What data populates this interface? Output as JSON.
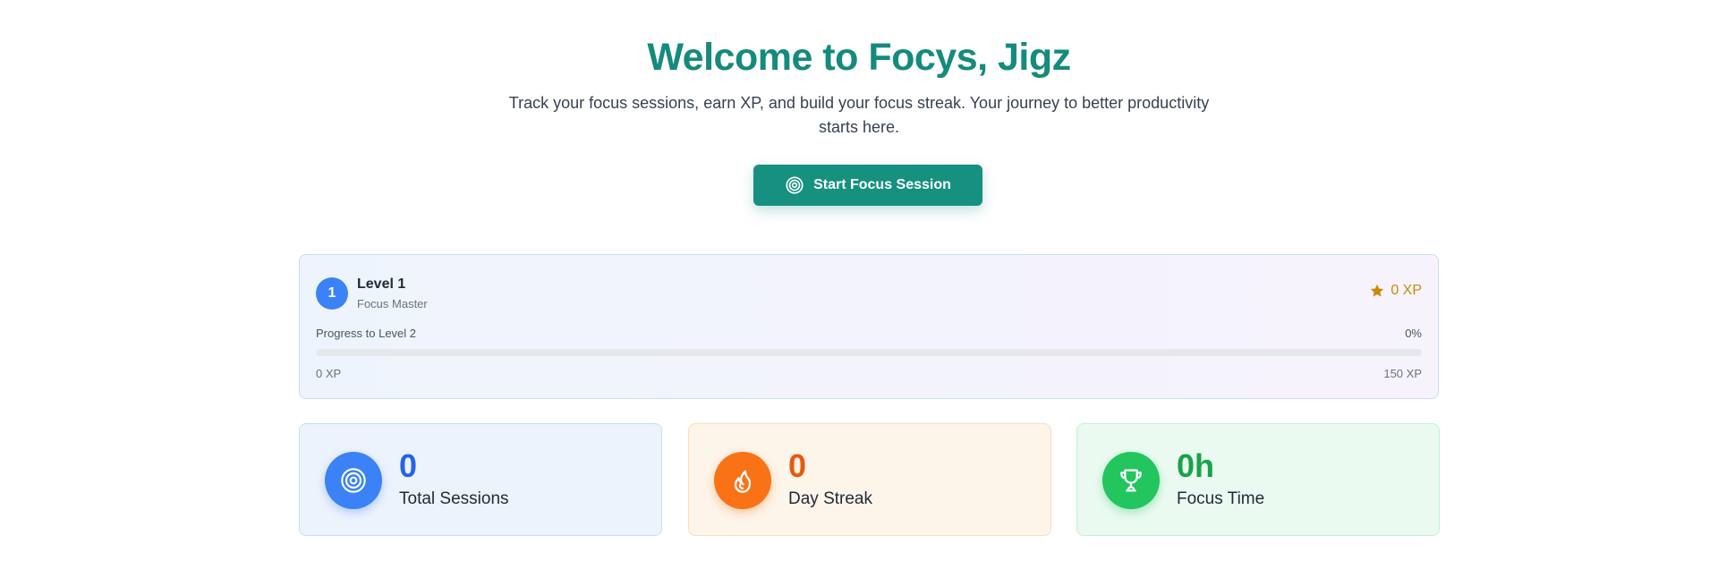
{
  "hero": {
    "title": "Welcome to Focys, Jigz",
    "subtitle": "Track your focus sessions, earn XP, and build your focus streak. Your journey to better productivity starts here.",
    "start_button": {
      "label": "Start Focus Session",
      "icon": "target-icon"
    }
  },
  "level": {
    "number": "1",
    "title": "Level 1",
    "subtitle": "Focus Master",
    "xp_label": "0 XP",
    "xp_icon": "star-icon",
    "progress_label": "Progress to Level 2",
    "progress_percent": "0%",
    "progress_value": 0,
    "xp_min": "0 XP",
    "xp_max": "150 XP"
  },
  "stats": [
    {
      "value": "0",
      "label": "Total Sessions",
      "icon": "target-icon",
      "color": "#3b82f6"
    },
    {
      "value": "0",
      "label": "Day Streak",
      "icon": "flame-icon",
      "color": "#f97316"
    },
    {
      "value": "0h",
      "label": "Focus Time",
      "icon": "trophy-icon",
      "color": "#22c55e"
    }
  ],
  "colors": {
    "brand": "#148b7c",
    "button": "#17917f",
    "xp": "#ca8a04"
  }
}
